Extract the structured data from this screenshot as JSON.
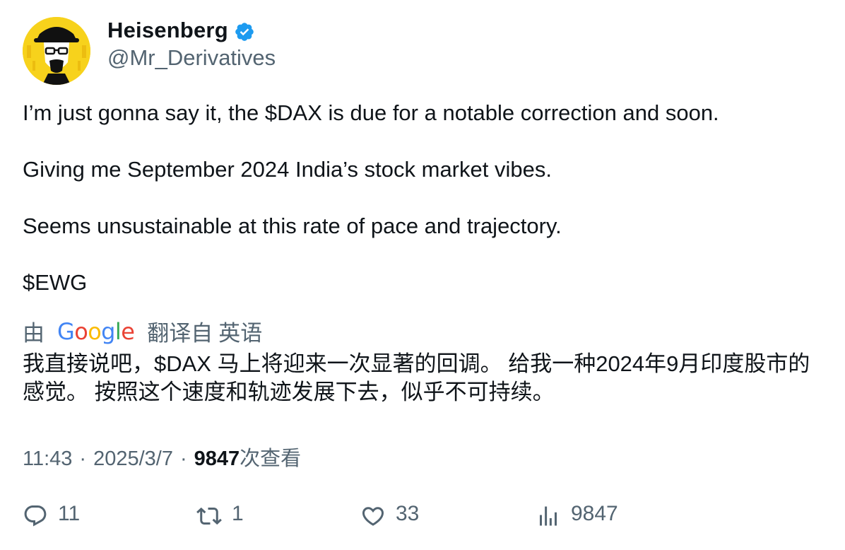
{
  "author": {
    "display_name": "Heisenberg",
    "handle": "@Mr_Derivatives",
    "verified_icon": "verified-badge-icon",
    "avatar_bg": "#f7d21c"
  },
  "tweet": {
    "paragraphs": [
      "I’m just gonna say it, the $DAX is due for a notable correction and soon.",
      "Giving me September 2024 India’s stock market vibes.",
      "Seems unsustainable at this rate of pace and trajectory.",
      "$EWG"
    ]
  },
  "translation": {
    "by_label": "由",
    "provider": "Google",
    "from_label": "翻译自",
    "source_language": "英语",
    "text": "我直接说吧，$DAX 马上将迎来一次显著的回调。 给我一种2024年9月印度股市的感觉。 按照这个速度和轨迹发展下去，似乎不可持续。"
  },
  "meta": {
    "time": "11:43",
    "separator": "·",
    "date": "2025/3/7",
    "views": "9847",
    "views_label": "次查看"
  },
  "actions": {
    "replies": "11",
    "retweets": "1",
    "likes": "33",
    "views": "9847"
  },
  "colors": {
    "text": "#0f1419",
    "secondary": "#536471",
    "verified": "#1d9bf0"
  }
}
